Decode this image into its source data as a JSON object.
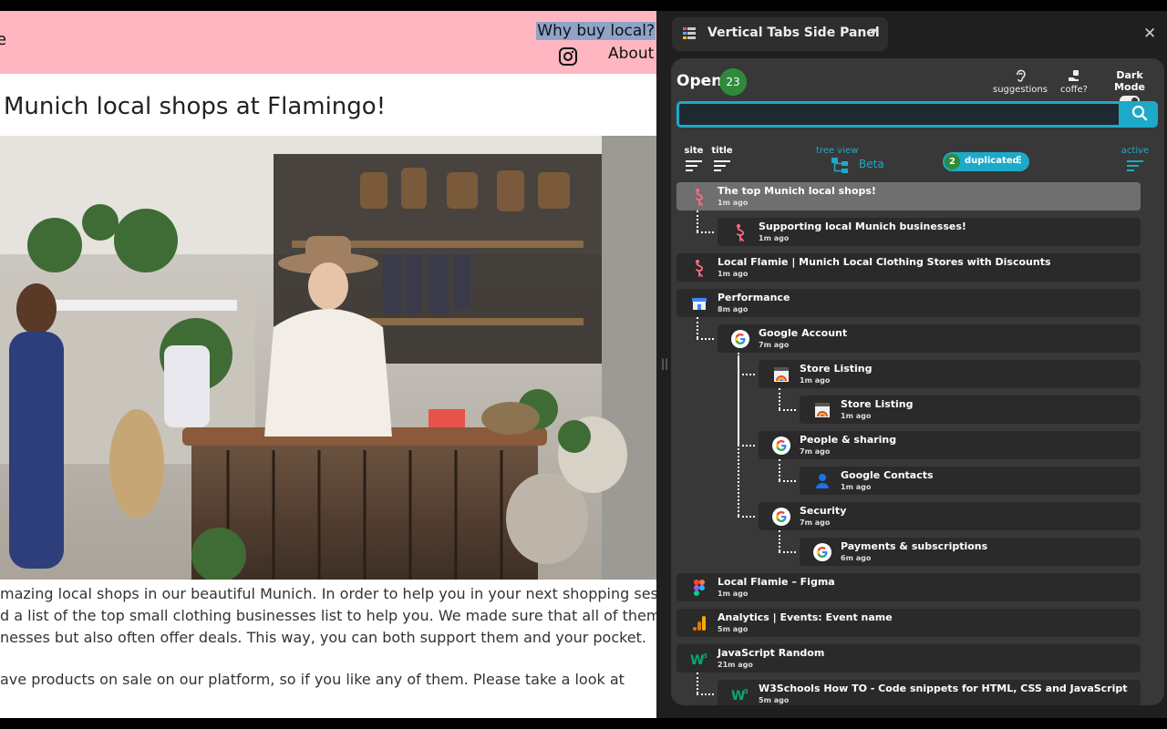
{
  "webpage": {
    "brand_fragment": "e",
    "nav": {
      "why_label": "Why buy local?",
      "about_label": "About"
    },
    "heading": "Munich local shops at Flamingo!",
    "paragraphs": [
      "mazing local shops in our beautiful Munich. In order to help you in your next shopping session",
      "d a list of the top small clothing businesses list to help you. We made sure that all of them are",
      "nesses but also often offer deals. This way, you can both support them and your pocket.",
      "ave products on sale on our platform, so if you like any of them. Please take a look at"
    ],
    "brand_color": "#ffb6c1"
  },
  "panel": {
    "title": "Vertical Tabs Side Panel",
    "open_label": "Open",
    "open_count": "23",
    "suggestions_label": "suggestions",
    "coffee_label": "coffe?",
    "dark_mode_label": "Dark Mode",
    "search_value": "",
    "sort_site_label": "site",
    "sort_title_label": "title",
    "tree_view_label": "tree view",
    "tree_view_badge": "Beta",
    "duplicated_count": "2",
    "duplicated_label": "duplicated",
    "sort_active_label": "active",
    "accent_color": "#1ea9c8",
    "tabs": [
      {
        "title": "The top Munich local shops!",
        "time": "1m ago",
        "icon": "flamingo-icon",
        "depth": 0,
        "active": true
      },
      {
        "title": "Supporting local Munich businesses!",
        "time": "1m ago",
        "icon": "flamingo-icon",
        "depth": 1
      },
      {
        "title": "Local Flamie | Munich Local Clothing Stores with Discounts",
        "time": "1m ago",
        "icon": "flamingo-icon",
        "depth": 0
      },
      {
        "title": "Performance",
        "time": "8m ago",
        "icon": "store-icon",
        "depth": 0
      },
      {
        "title": "Google Account",
        "time": "7m ago",
        "icon": "google-icon",
        "depth": 1
      },
      {
        "title": "Store Listing",
        "time": "1m ago",
        "icon": "rainbow-store-icon",
        "depth": 2
      },
      {
        "title": "Store Listing",
        "time": "1m ago",
        "icon": "rainbow-store-icon",
        "depth": 3
      },
      {
        "title": "People & sharing",
        "time": "7m ago",
        "icon": "google-icon",
        "depth": 2
      },
      {
        "title": "Google Contacts",
        "time": "1m ago",
        "icon": "contacts-icon",
        "depth": 3
      },
      {
        "title": "Security",
        "time": "7m ago",
        "icon": "google-icon",
        "depth": 2
      },
      {
        "title": "Payments & subscriptions",
        "time": "6m ago",
        "icon": "google-icon",
        "depth": 3
      },
      {
        "title": "Local Flamie – Figma",
        "time": "1m ago",
        "icon": "figma-icon",
        "depth": 0
      },
      {
        "title": "Analytics | Events: Event name",
        "time": "5m ago",
        "icon": "analytics-icon",
        "depth": 0
      },
      {
        "title": "JavaScript Random",
        "time": "21m ago",
        "icon": "w3schools-icon",
        "depth": 0
      },
      {
        "title": "W3Schools How TO - Code snippets for HTML, CSS and JavaScript",
        "time": "5m ago",
        "icon": "w3schools-icon",
        "depth": 1
      }
    ]
  }
}
